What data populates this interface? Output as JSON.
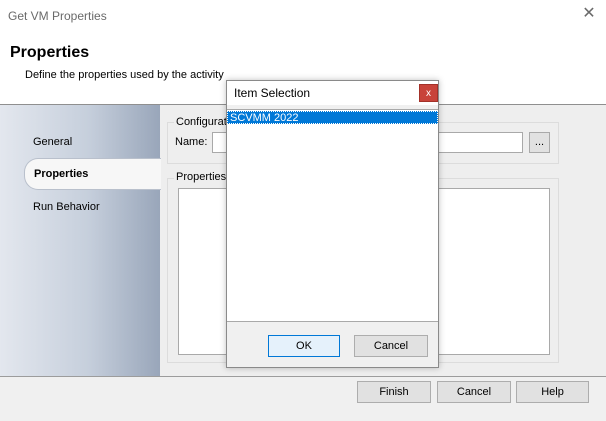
{
  "window": {
    "title": "Get VM Properties",
    "close_icon": "close-icon"
  },
  "header": {
    "title": "Properties",
    "subtitle": "Define the properties used by the activity"
  },
  "sidebar": {
    "items": [
      {
        "label": "General",
        "active": false
      },
      {
        "label": "Properties",
        "active": true
      },
      {
        "label": "Run Behavior",
        "active": false
      }
    ]
  },
  "main": {
    "config_group_label": "Configurati",
    "name_label": "Name:",
    "name_value": "",
    "browse_label": "...",
    "properties_group_label": "Properties"
  },
  "footer": {
    "finish_label": "Finish",
    "cancel_label": "Cancel",
    "help_label": "Help"
  },
  "dialog": {
    "title": "Item Selection",
    "close_label": "x",
    "items": [
      "SCVMM 2022"
    ],
    "selected_index": 0,
    "ok_label": "OK",
    "cancel_label": "Cancel"
  },
  "colors": {
    "selection": "#0078d7",
    "dialog_close": "#c8433a",
    "sidebar_gradient_end": "#99a6ba"
  }
}
